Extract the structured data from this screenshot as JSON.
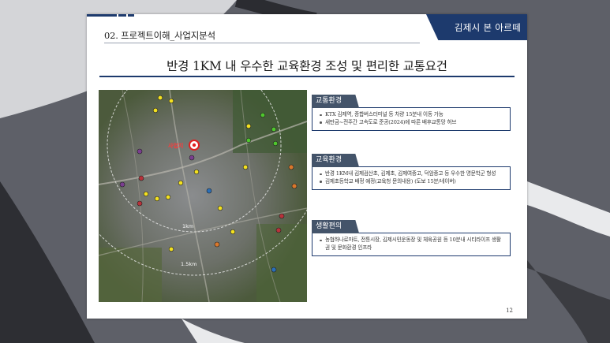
{
  "header": {
    "section_title": "02. 프로젝트이해_사업지분석",
    "brand": "김제시 본 아르떼"
  },
  "main_heading": "반경 1KM 내 우수한 교육환경 조성 및 편리한 교통요건",
  "map": {
    "site_label": "사업지",
    "ring_labels": [
      "1km",
      "1.5km"
    ],
    "marker_colors": {
      "yellow": "#f4e220",
      "green": "#4fc72d",
      "red": "#b8323a",
      "purple": "#7a3e8f",
      "blue": "#2a6fb8",
      "orange": "#d9782c",
      "site": "#e02020"
    }
  },
  "blocks": [
    {
      "tab": "교통환경",
      "items": [
        "KTX 김제역, 종합버스터미널 등 차량 15분내 이동 가능",
        "새만금~전주간 고속도로 준공(2024)에 따른 배후교통망 허브"
      ]
    },
    {
      "tab": "교육환경",
      "items": [
        "반경 1KM내 김제검산초, 김제초, 김제여중고, 덕암중고 등 우수한 명문학군 형성",
        "김제초등학교 배정 예정(교육청 문의내용) (도보 15분/네이버)"
      ]
    },
    {
      "tab": "생활편의",
      "items": [
        "농협하나로마트, 전통시장, 김제시민운동장 및 체육공원 등 10분내 시티라이프 생활권 및 문화환경 인프라"
      ]
    }
  ],
  "page_number": "12"
}
